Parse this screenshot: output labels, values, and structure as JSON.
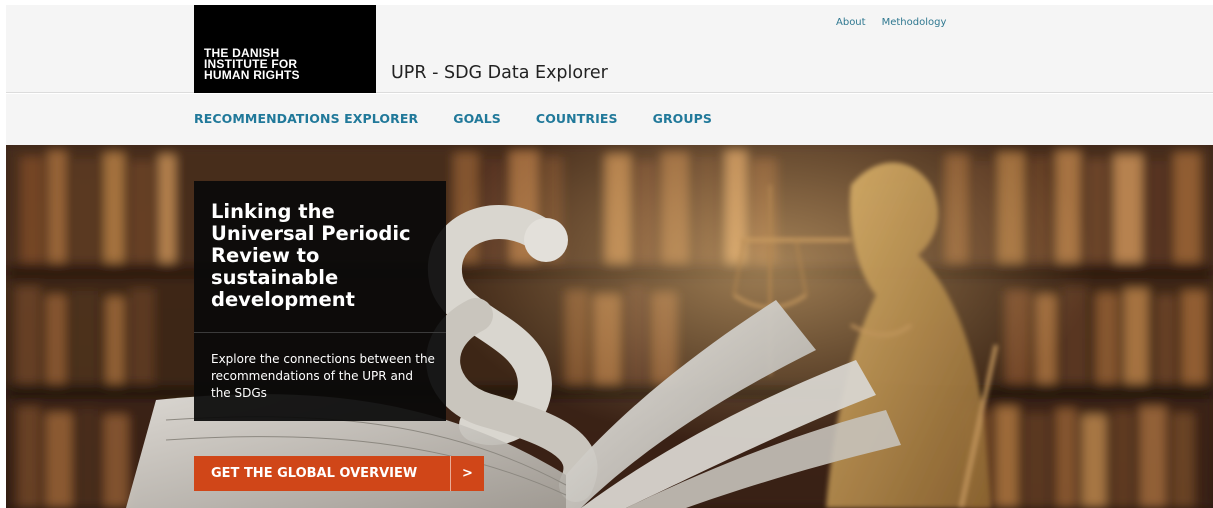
{
  "header": {
    "logo_lines": [
      "THE DANISH",
      "INSTITUTE FOR",
      "HUMAN RIGHTS"
    ],
    "site_title": "UPR - SDG Data Explorer",
    "top_links": [
      "About",
      "Methodology"
    ]
  },
  "nav": {
    "items": [
      "RECOMMENDATIONS EXPLORER",
      "GOALS",
      "COUNTRIES",
      "GROUPS"
    ]
  },
  "hero": {
    "heading": "Linking the Universal Periodic Review to sustainable development",
    "subtext": "Explore the connections between the recommendations of the UPR and the SDGs",
    "cta_label": "GET THE GLOBAL OVERVIEW",
    "cta_arrow": ">"
  },
  "colors": {
    "accent_teal": "#21799a",
    "cta_orange": "#d04618",
    "logo_black": "#000000"
  },
  "icons": {
    "cta_arrow": "chevron-right-icon"
  }
}
